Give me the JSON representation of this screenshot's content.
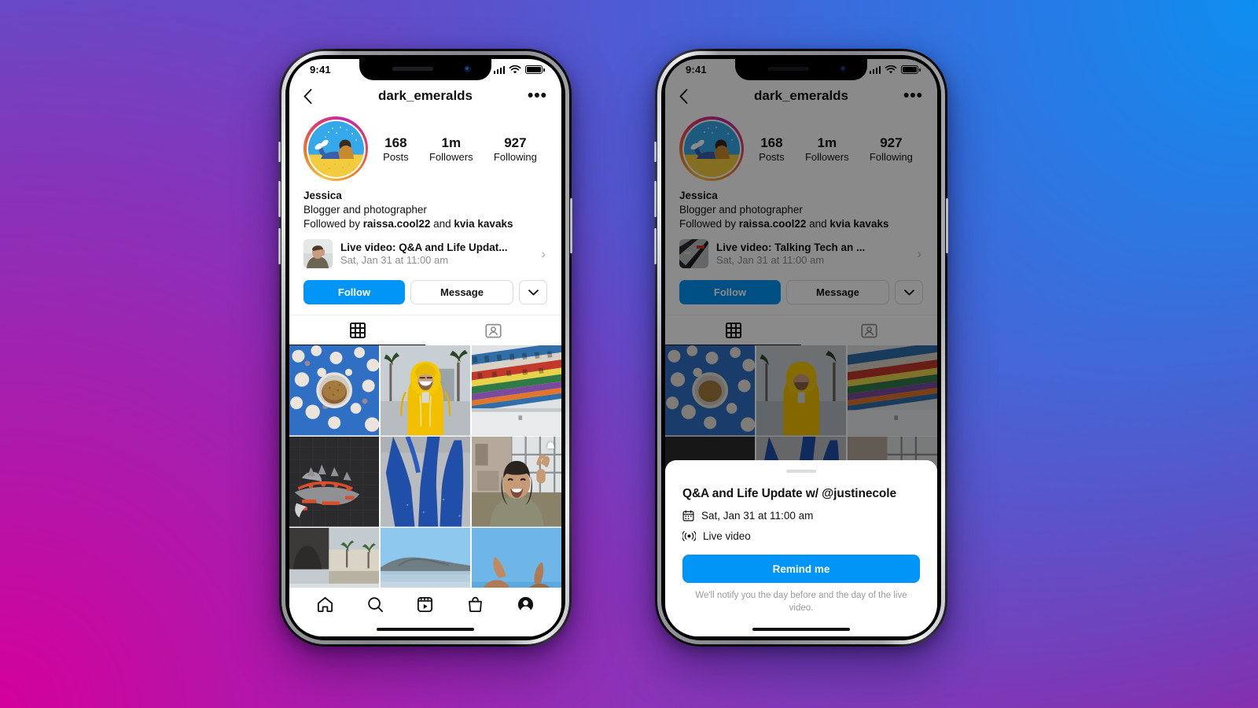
{
  "background": {
    "gradient_from": "#5b51c9",
    "gradient_magenta": "#d4009b",
    "gradient_blue": "#0d8ef0"
  },
  "accent_color": "#0095f6",
  "status_bar": {
    "time": "9:41",
    "signal_icon": "cellular-bars-icon",
    "wifi_icon": "wifi-icon",
    "battery_icon": "battery-full-icon"
  },
  "nav": {
    "back_icon": "chevron-left-icon",
    "title": "dark_emeralds",
    "more_label": "•••"
  },
  "profile": {
    "avatar_name": "profile-avatar",
    "stats": [
      {
        "value": "168",
        "label": "Posts"
      },
      {
        "value": "1m",
        "label": "Followers"
      },
      {
        "value": "927",
        "label": "Following"
      }
    ],
    "display_name": "Jessica",
    "bio": "Blogger and photographer",
    "followed_by_prefix": "Followed by ",
    "followed_by_first": "raissa.cool22",
    "followed_by_mid": " and ",
    "followed_by_second": "kvia  kavaks"
  },
  "live_banner_left": {
    "title": "Live video: Q&A and Life Updat...",
    "subtitle": "Sat, Jan 31 at 11:00 am",
    "chevron": "›"
  },
  "live_banner_right": {
    "title": "Live video: Talking Tech an ...",
    "subtitle": "Sat, Jan 31 at 11:00 am",
    "chevron": "›"
  },
  "actions": {
    "follow_label": "Follow",
    "message_label": "Message",
    "caret_icon": "chevron-down-icon"
  },
  "tabs": [
    {
      "name": "grid",
      "icon": "grid-icon",
      "active": true
    },
    {
      "name": "tagged",
      "icon": "tagged-person-icon",
      "active": false
    }
  ],
  "bottom_nav": [
    {
      "name": "home",
      "icon": "home-icon",
      "active": false
    },
    {
      "name": "search",
      "icon": "search-icon",
      "active": false
    },
    {
      "name": "reels",
      "icon": "reels-icon",
      "active": false
    },
    {
      "name": "shop",
      "icon": "shop-bag-icon",
      "active": false
    },
    {
      "name": "profile",
      "icon": "profile-avatar-icon",
      "active": true
    }
  ],
  "sheet": {
    "handle": "drag-handle",
    "title": "Q&A and Life Update w/ @justinecole",
    "date_icon": "calendar-icon",
    "date_text": "Sat, Jan 31 at 11:00 am",
    "type_icon": "live-broadcast-icon",
    "type_text": "Live video",
    "remind_label": "Remind me",
    "note": "We'll notify you the day before and the day of the live video."
  },
  "grid_posts": [
    {
      "alt": "blue-floral-tile-with-bread"
    },
    {
      "alt": "person-in-yellow-raincoat-palms"
    },
    {
      "alt": "colorful-striped-building"
    },
    {
      "alt": "red-dragon-mural-dark-wall"
    },
    {
      "alt": "blue-shadows-on-pavement"
    },
    {
      "alt": "smiling-person-peace-sign-indoors",
      "badge": "bell-icon"
    },
    {
      "alt": "palm-tree-street-scene"
    },
    {
      "alt": "coastline-blue-sky"
    },
    {
      "alt": "hands-against-blue-sky"
    }
  ]
}
